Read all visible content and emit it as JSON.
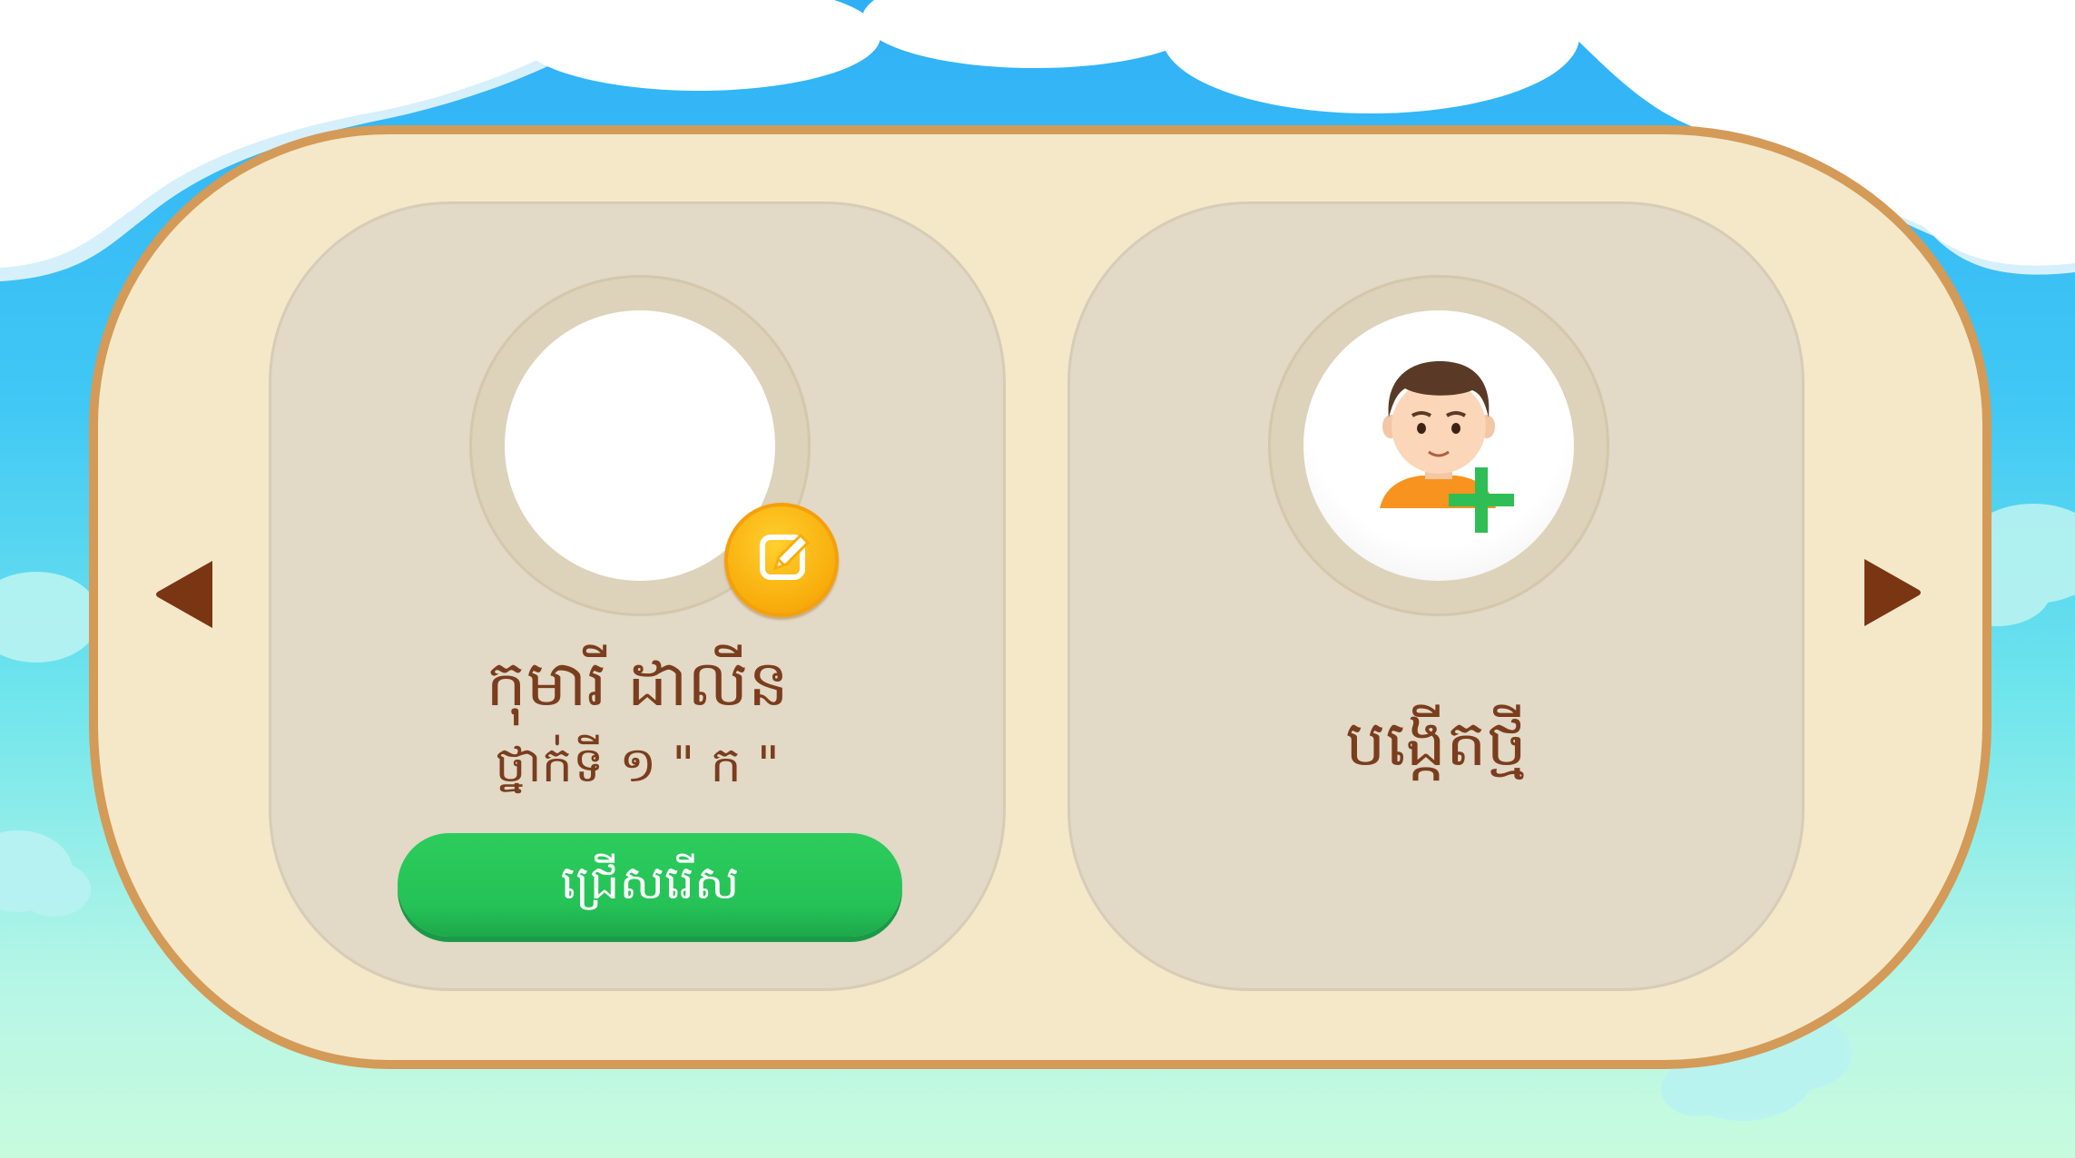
{
  "profiles": [
    {
      "name": "កុមារី ដាលីន",
      "grade": "ថ្នាក់ទី ១ \" ក \"",
      "select_label": "ជ្រើសរើស",
      "avatar_icon": "blank-avatar",
      "edit_icon": "pencil-edit-icon"
    }
  ],
  "create": {
    "label": "បង្កើតថ្មី",
    "icon": "add-user-icon"
  },
  "nav": {
    "prev_icon": "triangle-left-icon",
    "next_icon": "triangle-right-icon"
  },
  "colors": {
    "board_fill": "#f4e8c9",
    "board_border": "#d49a57",
    "card_fill": "#e2d9c6",
    "text_brown": "#7a3d1d",
    "select_green": "#25c257",
    "edit_orange": "#f8ad0b",
    "plus_green": "#2fbd55",
    "sky_blue": "#2fb0f6"
  }
}
